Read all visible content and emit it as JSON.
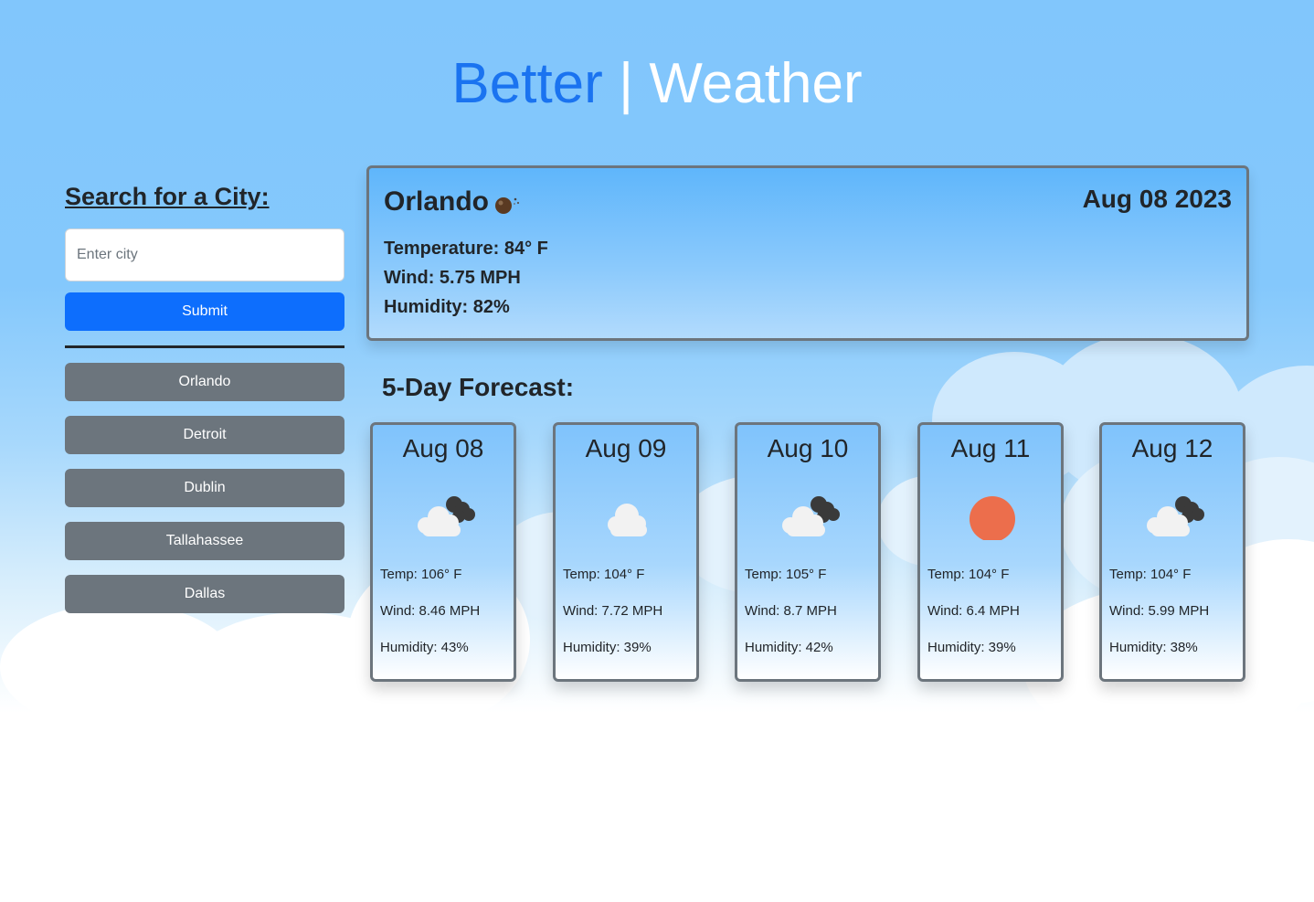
{
  "brand": {
    "part1": "Better",
    "separator": "|",
    "part2": "Weather"
  },
  "sidebar": {
    "heading": "Search for a City:",
    "input_value": "",
    "input_placeholder": "Enter city",
    "submit_label": "Submit",
    "history": [
      "Orlando",
      "Detroit",
      "Dublin",
      "Tallahassee",
      "Dallas"
    ]
  },
  "current": {
    "city": "Orlando",
    "icon": "bomb-icon",
    "date": "Aug 08 2023",
    "temperature": "Temperature: 84° F",
    "wind": "Wind: 5.75 MPH",
    "humidity": "Humidity: 82%"
  },
  "forecast": {
    "heading": "5-Day Forecast:",
    "days": [
      {
        "date": "Aug 08",
        "icon": "broken-clouds-icon",
        "temp": "Temp: 106° F",
        "wind": "Wind: 8.46 MPH",
        "humidity": "Humidity: 43%"
      },
      {
        "date": "Aug 09",
        "icon": "cloud-icon",
        "temp": "Temp: 104° F",
        "wind": "Wind: 7.72 MPH",
        "humidity": "Humidity: 39%"
      },
      {
        "date": "Aug 10",
        "icon": "broken-clouds-icon",
        "temp": "Temp: 105° F",
        "wind": "Wind: 8.7 MPH",
        "humidity": "Humidity: 42%"
      },
      {
        "date": "Aug 11",
        "icon": "sun-icon",
        "temp": "Temp: 104° F",
        "wind": "Wind: 6.4 MPH",
        "humidity": "Humidity: 39%"
      },
      {
        "date": "Aug 12",
        "icon": "broken-clouds-icon",
        "temp": "Temp: 104° F",
        "wind": "Wind: 5.99 MPH",
        "humidity": "Humidity: 38%"
      }
    ]
  },
  "colors": {
    "accent": "#0d6efd",
    "brand_blue": "#1a73f0",
    "history_button": "#6c757d",
    "sun": "#ec6e4c",
    "card_border": "#6c757d"
  }
}
